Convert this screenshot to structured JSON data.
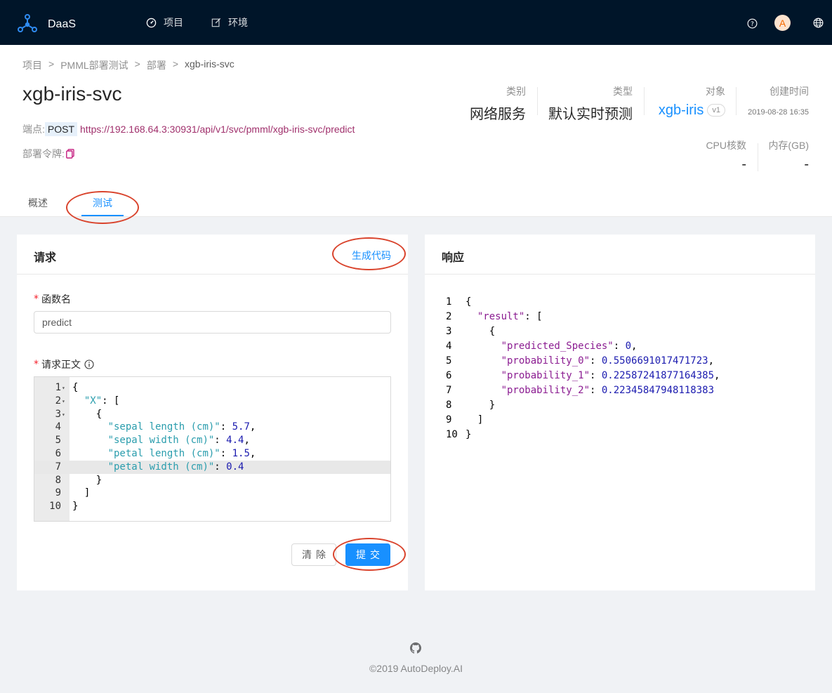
{
  "header": {
    "brand": "DaaS",
    "nav": [
      {
        "label": "项目",
        "icon": "dashboard-icon"
      },
      {
        "label": "环境",
        "icon": "edit-icon"
      }
    ],
    "avatar_initial": "A",
    "icons": [
      "help-icon",
      "globe-icon"
    ]
  },
  "breadcrumb": [
    "项目",
    "PMML部署测试",
    "部署",
    "xgb-iris-svc"
  ],
  "breadcrumb_sep": ">",
  "deployment": {
    "name": "xgb-iris-svc",
    "endpoint_label": "端点:",
    "method": "POST",
    "url": "https://192.168.64.3:30931/api/v1/svc/pmml/xgb-iris-svc/predict",
    "token_label": "部署令牌:"
  },
  "stats": {
    "category_label": "类别",
    "category": "网络服务",
    "type_label": "类型",
    "type": "默认实时预测",
    "object_label": "对象",
    "object": "xgb-iris",
    "object_version": "v1",
    "created_label": "创建时间",
    "created": "2019-08-28 16:35",
    "cpu_label": "CPU核数",
    "cpu": "-",
    "mem_label": "内存(GB)",
    "mem": "-"
  },
  "tabs": [
    {
      "label": "概述",
      "active": false
    },
    {
      "label": "测试",
      "active": true
    }
  ],
  "request": {
    "title": "请求",
    "gen_code": "生成代码",
    "fn_label": "函数名",
    "fn_value": "predict",
    "body_label": "请求正文",
    "clear_label": "清除",
    "submit_label": "提交"
  },
  "editor_lines": [
    {
      "n": "1",
      "fold": true,
      "code": "{"
    },
    {
      "n": "2",
      "fold": true,
      "code": "  \"X\": ["
    },
    {
      "n": "3",
      "fold": true,
      "code": "    {"
    },
    {
      "n": "4",
      "fold": false,
      "code": "      \"sepal length (cm)\": 5.7,"
    },
    {
      "n": "5",
      "fold": false,
      "code": "      \"sepal width (cm)\": 4.4,"
    },
    {
      "n": "6",
      "fold": false,
      "code": "      \"petal length (cm)\": 1.5,"
    },
    {
      "n": "7",
      "fold": false,
      "code": "      \"petal width (cm)\": 0.4",
      "active": true
    },
    {
      "n": "8",
      "fold": false,
      "code": "    }"
    },
    {
      "n": "9",
      "fold": false,
      "code": "  ]"
    },
    {
      "n": "10",
      "fold": false,
      "code": "}"
    }
  ],
  "response": {
    "title": "响应",
    "lines": [
      {
        "n": "1",
        "code": "{"
      },
      {
        "n": "2",
        "code": "  \"result\": ["
      },
      {
        "n": "3",
        "code": "    {"
      },
      {
        "n": "4",
        "code": "      \"predicted_Species\": 0,"
      },
      {
        "n": "5",
        "code": "      \"probability_0\": 0.5506691017471723,"
      },
      {
        "n": "6",
        "code": "      \"probability_1\": 0.22587241877164385,"
      },
      {
        "n": "7",
        "code": "      \"probability_2\": 0.22345847948118383"
      },
      {
        "n": "8",
        "code": "    }"
      },
      {
        "n": "9",
        "code": "  ]"
      },
      {
        "n": "10",
        "code": "}"
      }
    ]
  },
  "footer": {
    "copyright": "©2019 AutoDeploy.AI",
    "icon": "github-icon"
  },
  "colors": {
    "nav_bg": "#001529",
    "primary": "#1890ff",
    "annotation": "#d9432c",
    "url": "#a0306c"
  }
}
